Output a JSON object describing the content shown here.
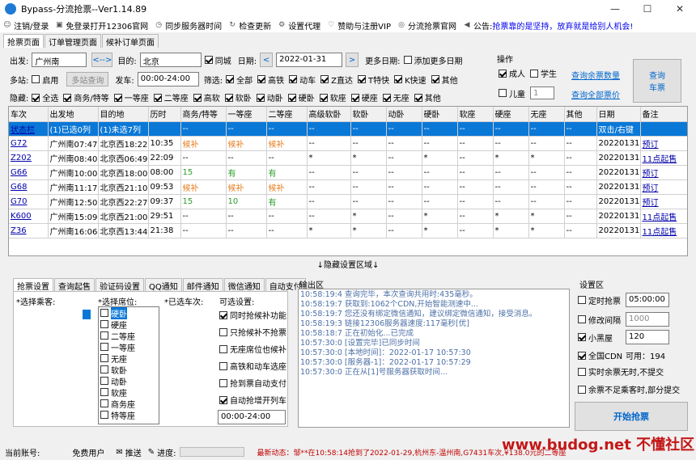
{
  "window": {
    "title": "Bypass-分流抢票--Ver1.14.89",
    "minimize": "—",
    "maximize": "☐",
    "close": "✕"
  },
  "menu": [
    {
      "label": "注销/登录",
      "icon": "user-icon"
    },
    {
      "label": "免登录打开12306官网",
      "icon": "save-icon"
    },
    {
      "label": "同步服务器时间",
      "icon": "clock-icon"
    },
    {
      "label": "检查更新",
      "icon": "refresh-icon"
    },
    {
      "label": "设置代理",
      "icon": "gear-icon"
    },
    {
      "label": "赞助与注册VIP",
      "icon": "heart-icon"
    },
    {
      "label": "分流抢票官网",
      "icon": "globe-icon"
    }
  ],
  "notice": {
    "label": "公告:",
    "text": "抢票靠的是坚持，放弃就是给别人机会!"
  },
  "tabs": [
    "抢票页面",
    "订单管理页面",
    "候补订单页面"
  ],
  "query": {
    "from_label": "出发:",
    "from": "广州南",
    "swap": "<-->",
    "to_label": "目的:",
    "to": "北京",
    "same_city": "同城",
    "date_label": "日期:",
    "date": "2022-01-31",
    "prev": "<",
    "next": ">",
    "more_dates_label": "更多日期:",
    "add_dates": "添加更多日期",
    "multi_label": "多站:",
    "enable": "启用",
    "multi_query": "多站查询",
    "depart_label": "发车:",
    "depart_time": "00:00-24:00",
    "filter_label": "筛选:",
    "filters": [
      "全部",
      "高铁",
      "动车",
      "Z直达",
      "T特快",
      "K快速",
      "其他"
    ],
    "hide_label": "隐藏:",
    "hides": [
      "全选",
      "商务/特等",
      "一等座",
      "二等座",
      "高软",
      "软卧",
      "动卧",
      "硬卧",
      "软座",
      "硬座",
      "无座",
      "其他"
    ]
  },
  "ops": {
    "title": "操作",
    "adult": "成人",
    "student": "学生",
    "child": "儿童",
    "child_count": "1",
    "query_remain": "查询余票数量",
    "query_price": "查询全部票价",
    "query_btn": "查询\n车票"
  },
  "grid": {
    "headers": [
      "车次",
      "出发地",
      "目的地",
      "历时",
      "商务/特等",
      "一等座",
      "二等座",
      "高级软卧",
      "软卧",
      "动卧",
      "硬卧",
      "软座",
      "硬座",
      "无座",
      "其他",
      "日期",
      "备注"
    ],
    "rows": [
      [
        "状态栏",
        "(1)已选0列",
        "(1)未选7列",
        "",
        "--",
        "--",
        "--",
        "--",
        "--",
        "--",
        "--",
        "--",
        "--",
        "--",
        "--",
        "双击/右键",
        ""
      ],
      [
        "G72",
        "广州南07:47",
        "北京西18:22",
        "10:35",
        "候补",
        "候补",
        "候补",
        "--",
        "--",
        "--",
        "--",
        "--",
        "--",
        "--",
        "--",
        "20220131",
        "预订"
      ],
      [
        "Z202",
        "广州南08:40",
        "北京西06:49",
        "22:09",
        "--",
        "--",
        "--",
        "*",
        "*",
        "--",
        "*",
        "--",
        "*",
        "*",
        "--",
        "20220131",
        "11点起售"
      ],
      [
        "G66",
        "广州南10:00",
        "北京西18:00",
        "08:00",
        "15",
        "有",
        "有",
        "--",
        "--",
        "--",
        "--",
        "--",
        "--",
        "--",
        "--",
        "20220131",
        "预订"
      ],
      [
        "G68",
        "广州南11:17",
        "北京西21:10",
        "09:53",
        "候补",
        "候补",
        "候补",
        "--",
        "--",
        "--",
        "--",
        "--",
        "--",
        "--",
        "--",
        "20220131",
        "预订"
      ],
      [
        "G70",
        "广州南12:50",
        "北京西22:27",
        "09:37",
        "15",
        "10",
        "有",
        "--",
        "--",
        "--",
        "--",
        "--",
        "--",
        "--",
        "--",
        "20220131",
        "预订"
      ],
      [
        "K600",
        "广州南15:09",
        "北京西21:00",
        "29:51",
        "--",
        "--",
        "--",
        "--",
        "*",
        "--",
        "*",
        "--",
        "*",
        "*",
        "--",
        "20220131",
        "11点起售"
      ],
      [
        "Z36",
        "广州南16:06",
        "北京西13:44",
        "21:38",
        "--",
        "--",
        "--",
        "*",
        "*",
        "--",
        "*",
        "--",
        "*",
        "*",
        "--",
        "20220131",
        "11点起售"
      ]
    ]
  },
  "divider": "↓隐藏设置区域↓",
  "btabs": [
    "抢票设置",
    "查询起售",
    "验证码设置",
    "QQ通知",
    "邮件通知",
    "微信通知",
    "自动支付"
  ],
  "settings": {
    "passenger_label": "*选择乘客:",
    "seat_label": "*选择席位:",
    "train_label": "*已选车次:",
    "opts_label": "可选设置:",
    "seats": [
      "硬卧",
      "硬座",
      "二等座",
      "一等座",
      "无座",
      "软卧",
      "动卧",
      "软座",
      "商务座",
      "特等座"
    ],
    "opts": [
      {
        "t": "同时抢候补功能",
        "on": true
      },
      {
        "t": "只抢候补不抢票",
        "on": false
      },
      {
        "t": "无座席位也候补",
        "on": false
      },
      {
        "t": "高铁和动车选座",
        "on": false
      },
      {
        "t": "抢到票自动支付",
        "on": false
      },
      {
        "t": "自动抢增开列车",
        "on": true
      }
    ],
    "time": "00:00-24:00"
  },
  "output": {
    "label": "输出区",
    "lines": [
      "10:58:19:4  查询完毕，本次查询共用时:435毫秒。",
      "10:58:19:7  获取到:1062个CDN,开始智能测速中...",
      "10:58:19:7  您还没有绑定微信通知，建议绑定微信通知，接受消息。",
      "10:58:19:3  链接12306服务器速度:117毫秒[优]",
      "10:58:18:7  正在初始化...已完成",
      "10:57:30:0  [设置完毕]已同步时间",
      "10:57:30:0  [本地时间]：2022-01-17 10:57:30",
      "10:57:30:0  [服务器-1]：2022-01-17 10:57:29",
      "10:57:30:0  正在从[1]号服务器获取时间..."
    ]
  },
  "setarea": {
    "label": "设置区",
    "timed": "定时抢票",
    "timed_val": "05:00:00",
    "interval": "修改间隔",
    "interval_val": "1000",
    "blackroom": "小黑屋",
    "blackroom_val": "120",
    "cdn": "全国CDN",
    "cdn_avail": "可用：194",
    "remain_notify": "实时余票无时,不提交",
    "partial": "余票不足乘客时,部分提交",
    "start": "开始抢票"
  },
  "status": {
    "account_label": "当前账号:",
    "account": "免费用户",
    "push": "推送",
    "progress": "进度:",
    "latest": "最新动态：邹**在10:58:14抢到了2022-01-29,杭州东-温州南,G7431车次,¥138.0元的二等座",
    "watermark": "www.budog.net 不懂社区"
  }
}
